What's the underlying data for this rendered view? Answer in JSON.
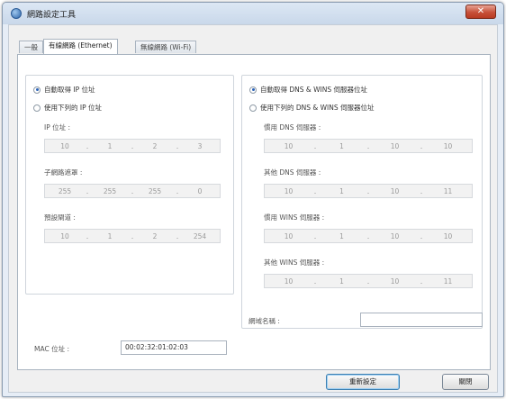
{
  "window": {
    "title": "網路設定工具",
    "close_label": "✕"
  },
  "tabs": [
    {
      "label": "一般"
    },
    {
      "label": "有線網路 (Ethernet)"
    },
    {
      "label": "無線網路 (Wi-Fi)"
    }
  ],
  "ip": {
    "auto_label": "自動取得 IP 位址",
    "manual_label": "使用下列的 IP 位址",
    "fields": [
      {
        "label": "IP 位址 :",
        "octets": [
          "10",
          "1",
          "2",
          "3"
        ]
      },
      {
        "label": "子網路遮罩 :",
        "octets": [
          "255",
          "255",
          "255",
          "0"
        ]
      },
      {
        "label": "預設閘道 :",
        "octets": [
          "10",
          "1",
          "2",
          "254"
        ]
      }
    ]
  },
  "dns": {
    "auto_label": "自動取得 DNS & WINS 伺服器位址",
    "manual_label": "使用下列的 DNS & WINS 伺服器位址",
    "fields": [
      {
        "label": "慣用 DNS 伺服器 :",
        "octets": [
          "10",
          "1",
          "10",
          "10"
        ]
      },
      {
        "label": "其他 DNS 伺服器 :",
        "octets": [
          "10",
          "1",
          "10",
          "11"
        ]
      },
      {
        "label": "慣用 WINS 伺服器 :",
        "octets": [
          "10",
          "1",
          "10",
          "10"
        ]
      },
      {
        "label": "其他 WINS 伺服器 :",
        "octets": [
          "10",
          "1",
          "10",
          "11"
        ]
      }
    ]
  },
  "hostname": {
    "label": "網域名稱 :",
    "value": ""
  },
  "mac": {
    "label": "MAC 位址 :",
    "value": "00:02:32:01:02:03"
  },
  "buttons": {
    "apply": "重新設定",
    "close": "關閉"
  }
}
